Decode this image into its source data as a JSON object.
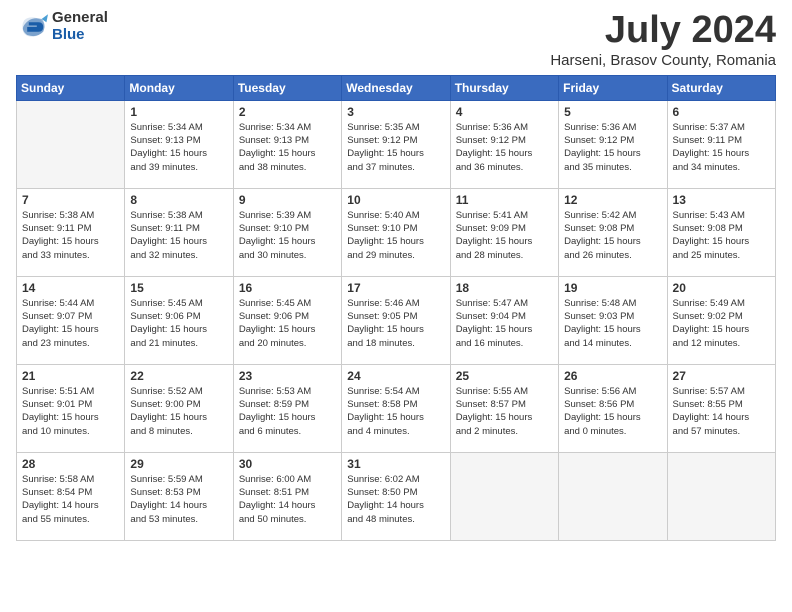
{
  "logo": {
    "general": "General",
    "blue": "Blue"
  },
  "title": "July 2024",
  "subtitle": "Harseni, Brasov County, Romania",
  "weekdays": [
    "Sunday",
    "Monday",
    "Tuesday",
    "Wednesday",
    "Thursday",
    "Friday",
    "Saturday"
  ],
  "weeks": [
    [
      {
        "day": "",
        "info": ""
      },
      {
        "day": "1",
        "info": "Sunrise: 5:34 AM\nSunset: 9:13 PM\nDaylight: 15 hours\nand 39 minutes."
      },
      {
        "day": "2",
        "info": "Sunrise: 5:34 AM\nSunset: 9:13 PM\nDaylight: 15 hours\nand 38 minutes."
      },
      {
        "day": "3",
        "info": "Sunrise: 5:35 AM\nSunset: 9:12 PM\nDaylight: 15 hours\nand 37 minutes."
      },
      {
        "day": "4",
        "info": "Sunrise: 5:36 AM\nSunset: 9:12 PM\nDaylight: 15 hours\nand 36 minutes."
      },
      {
        "day": "5",
        "info": "Sunrise: 5:36 AM\nSunset: 9:12 PM\nDaylight: 15 hours\nand 35 minutes."
      },
      {
        "day": "6",
        "info": "Sunrise: 5:37 AM\nSunset: 9:11 PM\nDaylight: 15 hours\nand 34 minutes."
      }
    ],
    [
      {
        "day": "7",
        "info": "Sunrise: 5:38 AM\nSunset: 9:11 PM\nDaylight: 15 hours\nand 33 minutes."
      },
      {
        "day": "8",
        "info": "Sunrise: 5:38 AM\nSunset: 9:11 PM\nDaylight: 15 hours\nand 32 minutes."
      },
      {
        "day": "9",
        "info": "Sunrise: 5:39 AM\nSunset: 9:10 PM\nDaylight: 15 hours\nand 30 minutes."
      },
      {
        "day": "10",
        "info": "Sunrise: 5:40 AM\nSunset: 9:10 PM\nDaylight: 15 hours\nand 29 minutes."
      },
      {
        "day": "11",
        "info": "Sunrise: 5:41 AM\nSunset: 9:09 PM\nDaylight: 15 hours\nand 28 minutes."
      },
      {
        "day": "12",
        "info": "Sunrise: 5:42 AM\nSunset: 9:08 PM\nDaylight: 15 hours\nand 26 minutes."
      },
      {
        "day": "13",
        "info": "Sunrise: 5:43 AM\nSunset: 9:08 PM\nDaylight: 15 hours\nand 25 minutes."
      }
    ],
    [
      {
        "day": "14",
        "info": "Sunrise: 5:44 AM\nSunset: 9:07 PM\nDaylight: 15 hours\nand 23 minutes."
      },
      {
        "day": "15",
        "info": "Sunrise: 5:45 AM\nSunset: 9:06 PM\nDaylight: 15 hours\nand 21 minutes."
      },
      {
        "day": "16",
        "info": "Sunrise: 5:45 AM\nSunset: 9:06 PM\nDaylight: 15 hours\nand 20 minutes."
      },
      {
        "day": "17",
        "info": "Sunrise: 5:46 AM\nSunset: 9:05 PM\nDaylight: 15 hours\nand 18 minutes."
      },
      {
        "day": "18",
        "info": "Sunrise: 5:47 AM\nSunset: 9:04 PM\nDaylight: 15 hours\nand 16 minutes."
      },
      {
        "day": "19",
        "info": "Sunrise: 5:48 AM\nSunset: 9:03 PM\nDaylight: 15 hours\nand 14 minutes."
      },
      {
        "day": "20",
        "info": "Sunrise: 5:49 AM\nSunset: 9:02 PM\nDaylight: 15 hours\nand 12 minutes."
      }
    ],
    [
      {
        "day": "21",
        "info": "Sunrise: 5:51 AM\nSunset: 9:01 PM\nDaylight: 15 hours\nand 10 minutes."
      },
      {
        "day": "22",
        "info": "Sunrise: 5:52 AM\nSunset: 9:00 PM\nDaylight: 15 hours\nand 8 minutes."
      },
      {
        "day": "23",
        "info": "Sunrise: 5:53 AM\nSunset: 8:59 PM\nDaylight: 15 hours\nand 6 minutes."
      },
      {
        "day": "24",
        "info": "Sunrise: 5:54 AM\nSunset: 8:58 PM\nDaylight: 15 hours\nand 4 minutes."
      },
      {
        "day": "25",
        "info": "Sunrise: 5:55 AM\nSunset: 8:57 PM\nDaylight: 15 hours\nand 2 minutes."
      },
      {
        "day": "26",
        "info": "Sunrise: 5:56 AM\nSunset: 8:56 PM\nDaylight: 15 hours\nand 0 minutes."
      },
      {
        "day": "27",
        "info": "Sunrise: 5:57 AM\nSunset: 8:55 PM\nDaylight: 14 hours\nand 57 minutes."
      }
    ],
    [
      {
        "day": "28",
        "info": "Sunrise: 5:58 AM\nSunset: 8:54 PM\nDaylight: 14 hours\nand 55 minutes."
      },
      {
        "day": "29",
        "info": "Sunrise: 5:59 AM\nSunset: 8:53 PM\nDaylight: 14 hours\nand 53 minutes."
      },
      {
        "day": "30",
        "info": "Sunrise: 6:00 AM\nSunset: 8:51 PM\nDaylight: 14 hours\nand 50 minutes."
      },
      {
        "day": "31",
        "info": "Sunrise: 6:02 AM\nSunset: 8:50 PM\nDaylight: 14 hours\nand 48 minutes."
      },
      {
        "day": "",
        "info": ""
      },
      {
        "day": "",
        "info": ""
      },
      {
        "day": "",
        "info": ""
      }
    ]
  ]
}
